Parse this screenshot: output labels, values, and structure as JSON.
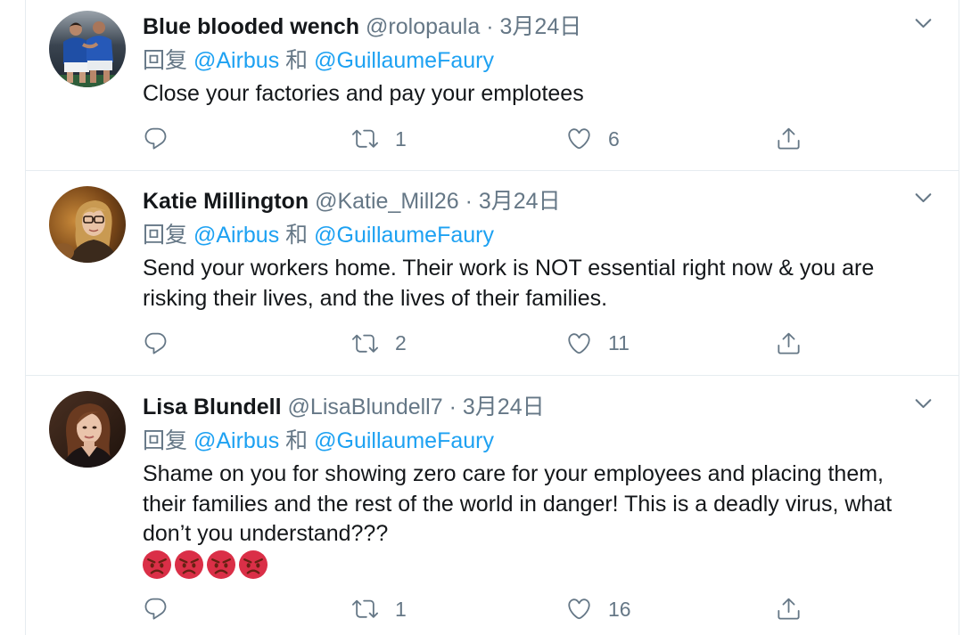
{
  "colors": {
    "name_text": "#14171a",
    "muted": "#657786",
    "link": "#1da1f2",
    "divider": "#e6ecf0",
    "emoji_face": "#da2f47"
  },
  "icons": {
    "reply": "reply-icon",
    "retweet": "retweet-icon",
    "like": "heart-icon",
    "share": "share-icon",
    "more": "chevron-down-icon"
  },
  "tweets": [
    {
      "name": "Blue blooded wench",
      "handle": "@rolopaula",
      "separator": "·",
      "date": "3月24日",
      "reply_prefix": "回复",
      "reply_to": [
        "@Airbus",
        "@GuillaumeFaury"
      ],
      "reply_conjunction": "和",
      "text_lines": [
        "Close your factories and pay your emplotees"
      ],
      "emoji": [],
      "retweets": "1",
      "likes": "6"
    },
    {
      "name": "Katie Millington",
      "handle": "@Katie_Mill26",
      "separator": "·",
      "date": "3月24日",
      "reply_prefix": "回复",
      "reply_to": [
        "@Airbus",
        "@GuillaumeFaury"
      ],
      "reply_conjunction": "和",
      "text_lines": [
        "Send your workers home. Their work is NOT essential right now & you are",
        "risking their lives, and the lives of their families."
      ],
      "emoji": [],
      "retweets": "2",
      "likes": "11"
    },
    {
      "name": "Lisa Blundell",
      "handle": "@LisaBlundell7",
      "separator": "·",
      "date": "3月24日",
      "reply_prefix": "回复",
      "reply_to": [
        "@Airbus",
        "@GuillaumeFaury"
      ],
      "reply_conjunction": "和",
      "text_lines": [
        "Shame on you for showing zero care for your employees and placing them,",
        "their families and the rest of the world in danger! This is a deadly virus, what",
        "don’t you understand???"
      ],
      "emoji": [
        "pouting-face",
        "pouting-face",
        "pouting-face",
        "pouting-face"
      ],
      "retweets": "1",
      "likes": "16"
    }
  ]
}
